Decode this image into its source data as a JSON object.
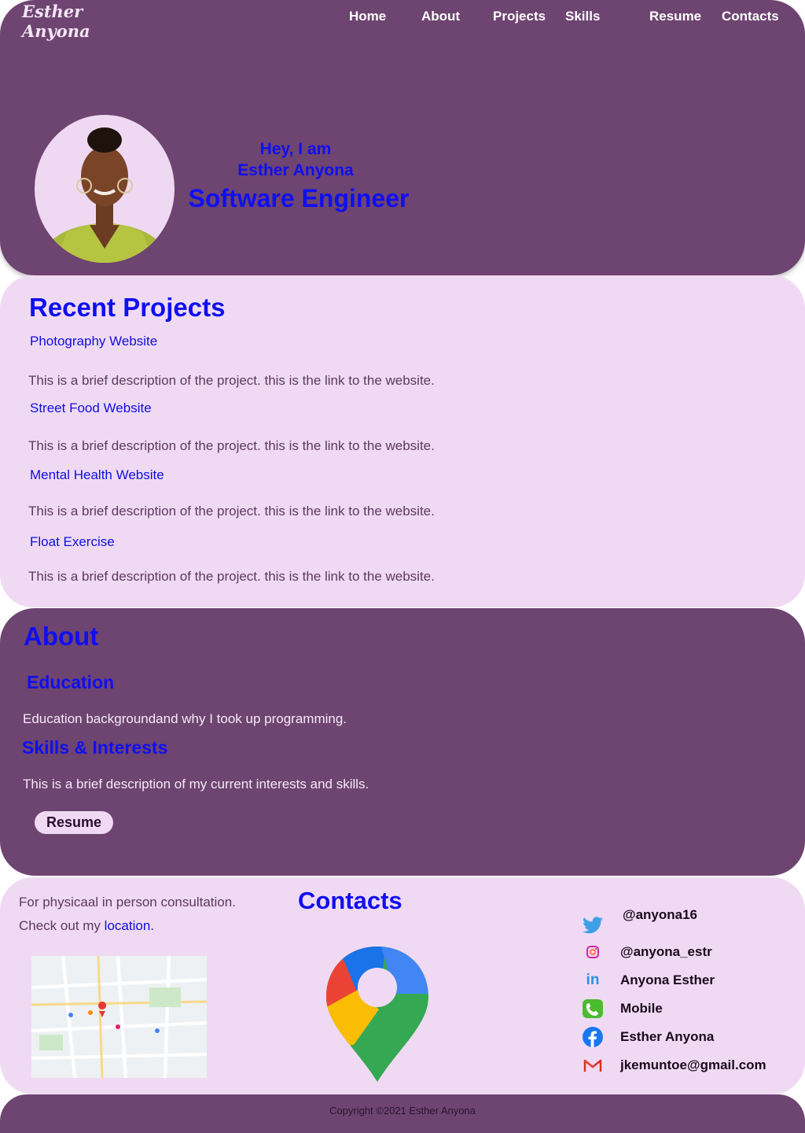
{
  "header": {
    "logo": [
      "Esther",
      "Anyona"
    ],
    "nav": [
      "Home",
      "About",
      "Projects",
      "Skills",
      "Resume",
      "Contacts"
    ]
  },
  "hero": {
    "greeting": "Hey, I am",
    "name": "Esther Anyona",
    "role": "Software Engineer"
  },
  "projects": {
    "heading": "Recent Projects",
    "items": [
      {
        "title": "Photography Website",
        "desc": "This is a brief description of the project. this is the link to the website."
      },
      {
        "title": "Street Food Website",
        "desc": "This is a brief description of the project. this is the link to the website."
      },
      {
        "title": "Mental Health Website",
        "desc": "This is a brief description of the project. this is the link to the website."
      },
      {
        "title": "Float Exercise",
        "desc": "This is a brief description of the project. this is the link to the website."
      }
    ]
  },
  "about": {
    "heading": "About",
    "education_heading": "Education",
    "education_text": "Education backgroundand why I took up programming.",
    "skills_heading": "Skills & Interests",
    "skills_text": "This is a brief description of my current interests and skills.",
    "resume_label": "Resume"
  },
  "contacts": {
    "heading": "Contacts",
    "line1": "For physicaal in person consultation.",
    "line2_prefix": "Check out my",
    "location_link": "location.",
    "social": [
      {
        "icon": "twitter-icon",
        "label": "@anyona16",
        "color": "#1da1f2"
      },
      {
        "icon": "instagram-icon",
        "label": "@anyona_estr",
        "color": "#d6249f"
      },
      {
        "icon": "linkedin-icon",
        "label": "Anyona Esther",
        "color": "#2f8fe0"
      },
      {
        "icon": "phone-icon",
        "label": "Mobile",
        "color": "#4caf50"
      },
      {
        "icon": "facebook-icon",
        "label": "Esther Anyona",
        "color": "#1877f2"
      },
      {
        "icon": "gmail-icon",
        "label": "jkemuntoe@gmail.com",
        "color": "#d93025"
      }
    ]
  },
  "footer": {
    "copyright": "Copyright ©2021 Esther Anyona"
  },
  "colors": {
    "purple": "#6e4471",
    "lavender": "#f0daf3",
    "accent_blue": "#0f0ff0"
  }
}
